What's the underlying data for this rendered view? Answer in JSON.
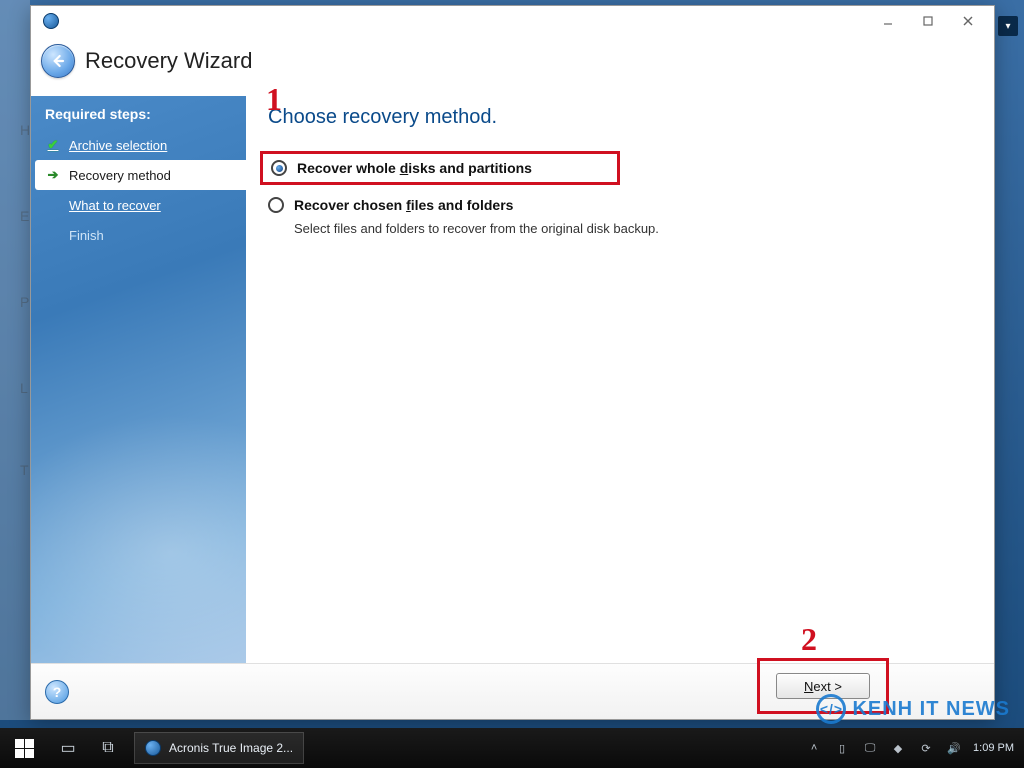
{
  "window": {
    "title": "Recovery Wizard"
  },
  "sidebar": {
    "heading": "Required steps:",
    "steps": [
      {
        "label": "Archive selection",
        "state": "done"
      },
      {
        "label": "Recovery method",
        "state": "current"
      },
      {
        "label": "What to recover",
        "state": "link"
      },
      {
        "label": "Finish",
        "state": "disabled"
      }
    ]
  },
  "content": {
    "title": "Choose recovery method.",
    "options": [
      {
        "label_pre": "Recover whole ",
        "label_ul": "d",
        "label_post": "isks and partitions",
        "selected": true,
        "desc": ""
      },
      {
        "label_pre": "Recover chosen ",
        "label_ul": "f",
        "label_post": "iles and folders",
        "selected": false,
        "desc": "Select files and folders to recover from the original disk backup."
      }
    ]
  },
  "footer": {
    "next_pre": "",
    "next_ul": "N",
    "next_post": "ext >"
  },
  "annotations": {
    "a1": "1",
    "a2": "2"
  },
  "taskbar": {
    "task_label": "Acronis True Image 2...",
    "time": "1:09 PM"
  },
  "watermark": {
    "text": "KENH IT NEWS"
  },
  "bg_letters": [
    "H",
    "E",
    "P",
    "L",
    "T"
  ]
}
